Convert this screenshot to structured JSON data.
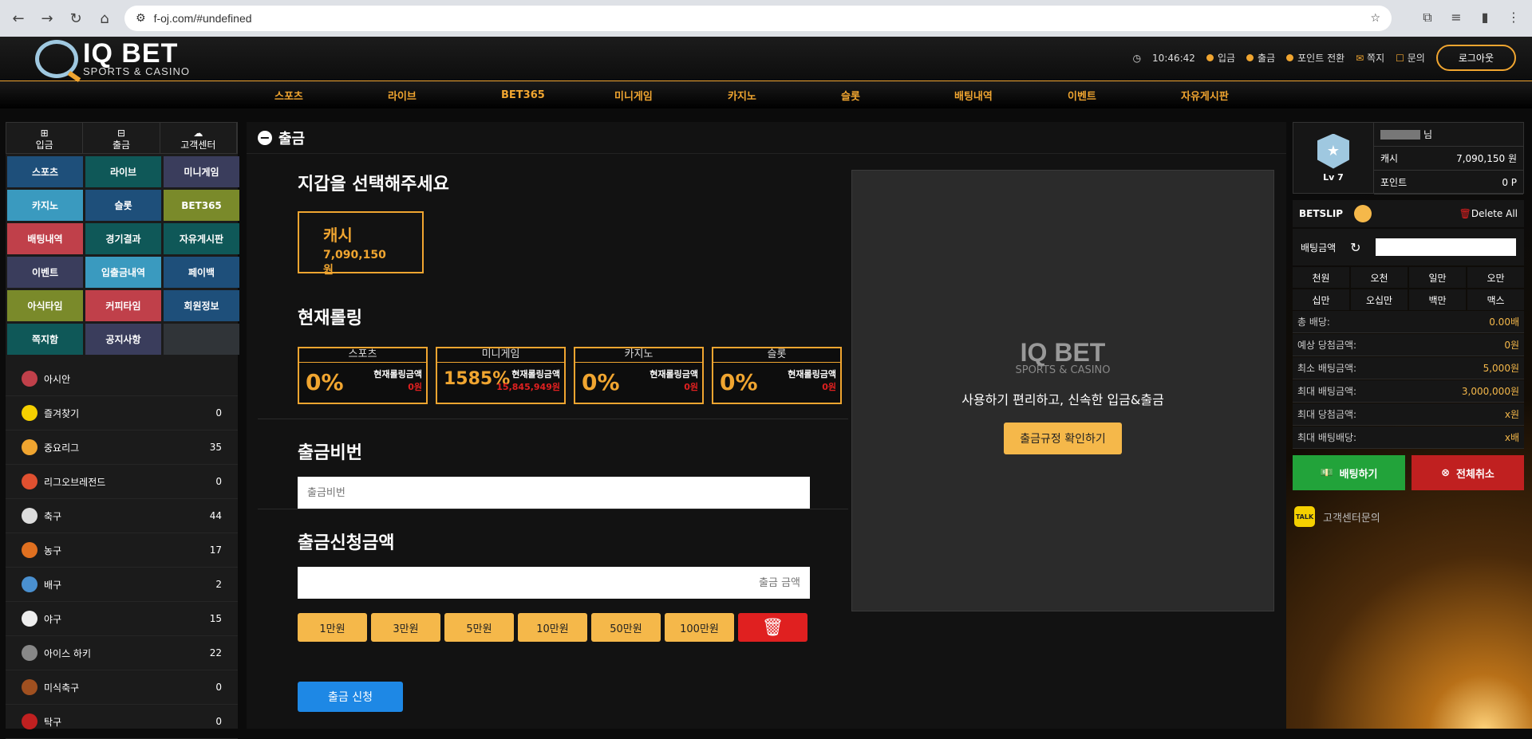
{
  "browser": {
    "url": "f-oj.com/#undefined"
  },
  "brand": {
    "name": "IQ BET",
    "tagline": "SPORTS & CASINO"
  },
  "header": {
    "time": "10:46:42",
    "links": [
      "입금",
      "출금",
      "포인트 전환",
      "쪽지",
      "문의"
    ],
    "logout": "로그아웃"
  },
  "nav": [
    "스포츠",
    "라이브",
    "BET365",
    "미니게임",
    "카지노",
    "슬롯",
    "배팅내역",
    "이벤트",
    "자유게시판"
  ],
  "sidebar": {
    "tabs": [
      "입금",
      "출금",
      "고객센터"
    ],
    "grid": [
      {
        "label": "스포츠",
        "color": "#1e4f7a"
      },
      {
        "label": "라이브",
        "color": "#0f5858"
      },
      {
        "label": "미니게임",
        "color": "#3a3d5c"
      },
      {
        "label": "카지노",
        "color": "#3a9abf"
      },
      {
        "label": "슬롯",
        "color": "#1e4f7a"
      },
      {
        "label": "BET365",
        "color": "#7a8a2a"
      },
      {
        "label": "배팅내역",
        "color": "#c0404a"
      },
      {
        "label": "경기결과",
        "color": "#0f5858"
      },
      {
        "label": "자유게시판",
        "color": "#0f5858"
      },
      {
        "label": "이벤트",
        "color": "#3a3d5c"
      },
      {
        "label": "입출금내역",
        "color": "#3a9abf"
      },
      {
        "label": "페이백",
        "color": "#1e4f7a"
      },
      {
        "label": "아식타임",
        "color": "#7a8a2a"
      },
      {
        "label": "커피타임",
        "color": "#c0404a"
      },
      {
        "label": "회원정보",
        "color": "#1e4f7a"
      },
      {
        "label": "쪽지함",
        "color": "#0f5858"
      },
      {
        "label": "공지사항",
        "color": "#3a3d5c"
      },
      {
        "label": "",
        "color": "#303438"
      }
    ],
    "leagues": [
      {
        "name": "아시안",
        "count": "",
        "icon": "asian-icon",
        "color": "#c0404a"
      },
      {
        "name": "즐겨찾기",
        "count": "0",
        "icon": "star-icon",
        "color": "#f5d000"
      },
      {
        "name": "중요리그",
        "count": "35",
        "icon": "trophy-icon",
        "color": "#f0a530"
      },
      {
        "name": "리그오브레전드",
        "count": "0",
        "icon": "lol-icon",
        "color": "#e05030"
      },
      {
        "name": "축구",
        "count": "44",
        "icon": "soccer-icon",
        "color": "#dddddd"
      },
      {
        "name": "농구",
        "count": "17",
        "icon": "basketball-icon",
        "color": "#e07020"
      },
      {
        "name": "배구",
        "count": "2",
        "icon": "volleyball-icon",
        "color": "#4a90d0"
      },
      {
        "name": "야구",
        "count": "15",
        "icon": "baseball-icon",
        "color": "#eeeeee"
      },
      {
        "name": "아이스 하키",
        "count": "22",
        "icon": "hockey-icon",
        "color": "#888888"
      },
      {
        "name": "미식축구",
        "count": "0",
        "icon": "football-icon",
        "color": "#a05020"
      },
      {
        "name": "탁구",
        "count": "0",
        "icon": "pingpong-icon",
        "color": "#c02020"
      }
    ]
  },
  "withdraw": {
    "title": "출금",
    "wallet_heading": "지갑을 선택해주세요",
    "wallet": {
      "name": "캐시",
      "amount": "7,090,150 원"
    },
    "rolling_heading": "현재롤링",
    "rolling": [
      {
        "name": "스포츠",
        "pct": "0%",
        "label": "현재롤링금액",
        "amount": "0원"
      },
      {
        "name": "미니게임",
        "pct": "1585%",
        "label": "현재롤링금액",
        "amount": "15,845,949원"
      },
      {
        "name": "카지노",
        "pct": "0%",
        "label": "현재롤링금액",
        "amount": "0원"
      },
      {
        "name": "슬롯",
        "pct": "0%",
        "label": "현재롤링금액",
        "amount": "0원"
      }
    ],
    "pw_heading": "출금비번",
    "pw_placeholder": "출금비번",
    "amount_heading": "출금신청금액",
    "amount_placeholder": "출금 금액",
    "amount_buttons": [
      "1만원",
      "3만원",
      "5만원",
      "10만원",
      "50만원",
      "100만원"
    ],
    "submit": "출금 신청"
  },
  "promo": {
    "text": "사용하기 편리하고, 신속한 입금&출금",
    "button": "출금규정 확인하기"
  },
  "profile": {
    "level": "Lv 7",
    "suffix": "님",
    "cash_label": "캐시",
    "cash": "7,090,150 원",
    "point_label": "포인트",
    "point": "0 P"
  },
  "betslip": {
    "title": "BETSLIP",
    "delete": "Delete All",
    "bet_amount": "배팅금액",
    "quick": [
      "천원",
      "오천",
      "일만",
      "오만",
      "십만",
      "오십만",
      "백만",
      "맥스"
    ],
    "stats": [
      {
        "label": "총 배당:",
        "value": "0.00배"
      },
      {
        "label": "예상 당첨금액:",
        "value": "0원"
      },
      {
        "label": "최소 배팅금액:",
        "value": "5,000원"
      },
      {
        "label": "최대 배팅금액:",
        "value": "3,000,000원"
      },
      {
        "label": "최대 당첨금액:",
        "value": "x원"
      },
      {
        "label": "최대 배팅배당:",
        "value": "x배"
      }
    ],
    "bet": "배팅하기",
    "cancel": "전체취소",
    "support": "고객센터문의"
  }
}
